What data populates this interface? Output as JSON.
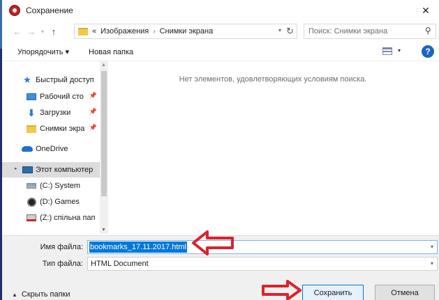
{
  "window": {
    "title": "Сохранение",
    "close_glyph": "✕"
  },
  "navigation": {
    "back_glyph": "←",
    "forward_glyph": "→",
    "dropdown_glyph": "▾",
    "up_glyph": "↑"
  },
  "address": {
    "overflow": "«",
    "parts": [
      "Изображения",
      "Снимки экрана"
    ],
    "separator": "›",
    "dropdown_glyph": "▾",
    "refresh_glyph": "↻"
  },
  "search": {
    "placeholder": "Поиск: Снимки экрана",
    "icon": "search-icon"
  },
  "toolbar": {
    "organize_label": "Упорядочить ▾",
    "new_folder_label": "Новая папка",
    "view_dropdown_glyph": "▾",
    "help_label": "?"
  },
  "sidebar": {
    "pin_glyph": "📌",
    "expander_glyph": "▸",
    "items": [
      {
        "label": "Быстрый доступ",
        "icon": "star-icon",
        "glyph": "★"
      },
      {
        "label": "Рабочий сто",
        "icon": "desktop-icon",
        "pinned": true
      },
      {
        "label": "Загрузки",
        "icon": "download-icon",
        "glyph": "⬇",
        "pinned": true
      },
      {
        "label": "Снимки экра",
        "icon": "folder-icon",
        "pinned": true
      },
      {
        "label": "OneDrive",
        "icon": "cloud-icon"
      },
      {
        "label": "Этот компьютер",
        "icon": "computer-icon",
        "selected": true
      },
      {
        "label": "(C:) System",
        "icon": "drive-icon"
      },
      {
        "label": "(D:) Games",
        "icon": "games-drive-icon"
      },
      {
        "label": "(Z:) спільна пап",
        "icon": "network-drive-icon"
      }
    ],
    "scroll": {
      "up_glyph": "▲",
      "down_glyph": "▼"
    }
  },
  "content": {
    "empty_message": "Нет элементов, удовлетворяющих условиям поиска."
  },
  "form": {
    "filename_label": "Имя файла:",
    "filename_value": "bookmarks_17.11.2017.html",
    "filetype_label": "Тип файла:",
    "filetype_value": "HTML Document",
    "dropdown_glyph": "▾"
  },
  "footer": {
    "hide_folders_chevron": "▲",
    "hide_folders_label": "Скрыть папки",
    "save_label": "Сохранить",
    "cancel_label": "Отмена"
  },
  "colors": {
    "accent": "#0078d7",
    "annotation_arrow": "#d9232d",
    "help": "#1a66c2"
  }
}
